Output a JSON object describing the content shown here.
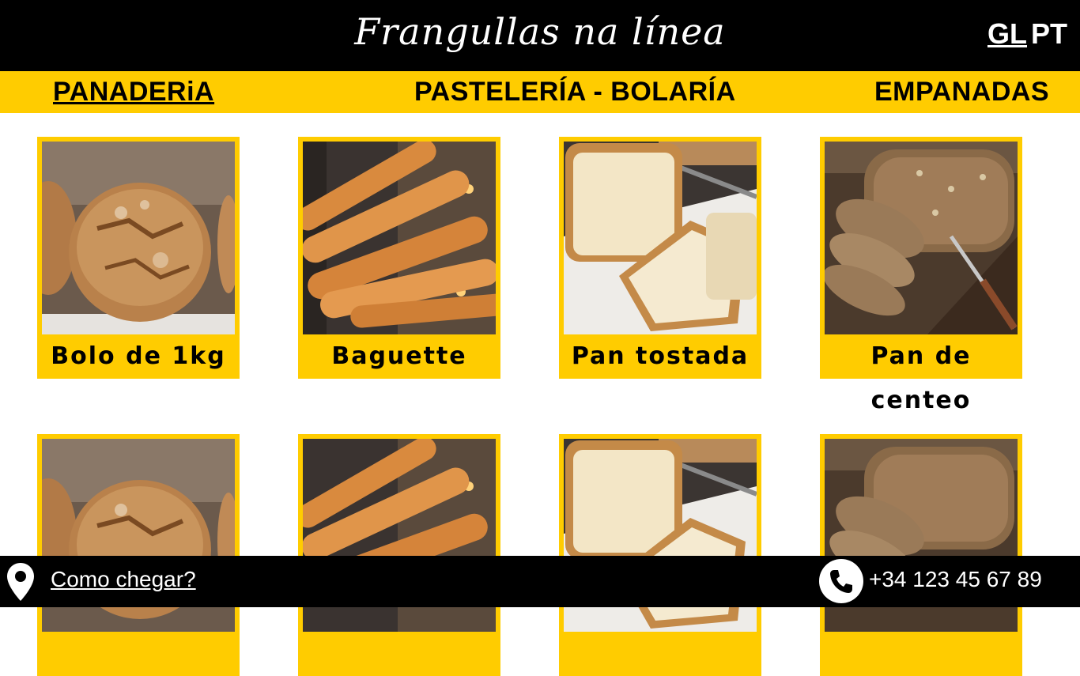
{
  "header": {
    "title": "Frangullas na línea",
    "languages": [
      {
        "label": "GL",
        "active": true
      },
      {
        "label": "PT",
        "active": false
      }
    ]
  },
  "nav": {
    "items": [
      {
        "label": "PANADERiA",
        "active": true
      },
      {
        "label": "PASTELERÍA - BOLARÍA",
        "active": false
      },
      {
        "label": "EMPANADAS",
        "active": false
      }
    ]
  },
  "products": [
    {
      "label": "Bolo de 1kg",
      "image": "round-bread-loaf"
    },
    {
      "label": "Baguette",
      "image": "baguettes"
    },
    {
      "label": "Pan tostada",
      "image": "sliced-white-bread"
    },
    {
      "label": "Pan de centeo",
      "image": "sliced-rye-bread"
    }
  ],
  "footer": {
    "directions_label": "Como chegar?",
    "phone": "+34 123 45 67 89",
    "location_icon": "map-pin-icon",
    "phone_icon": "phone-icon"
  },
  "colors": {
    "accent": "#ffcc00",
    "bar": "#000000",
    "background": "#ffffff"
  }
}
